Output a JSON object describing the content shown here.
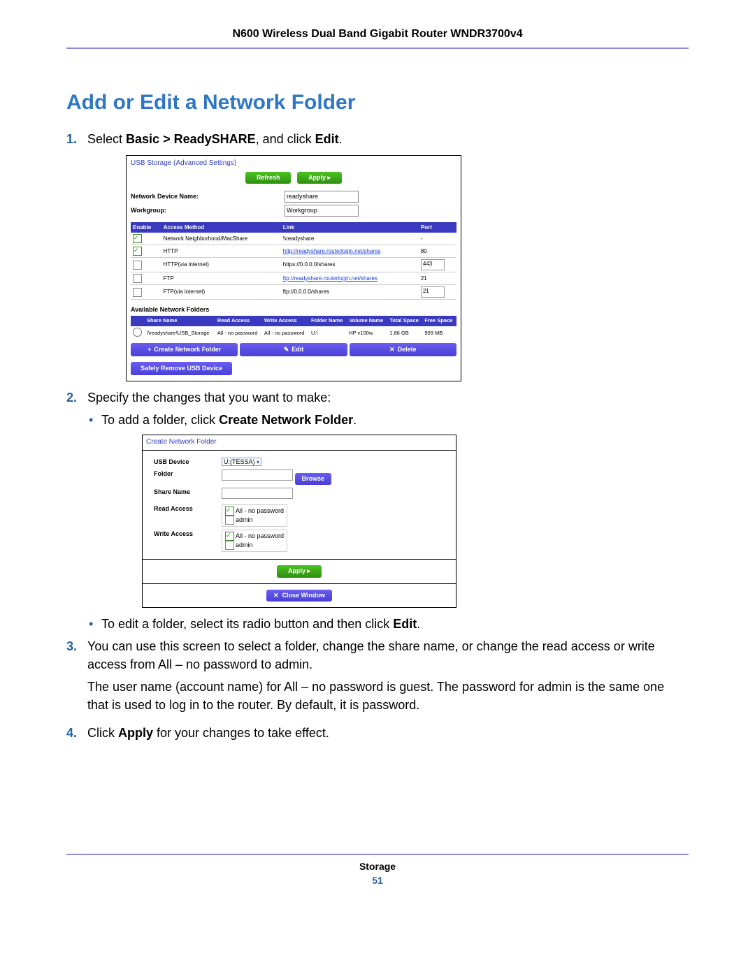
{
  "header": "N600 Wireless Dual Band Gigabit Router WNDR3700v4",
  "title": "Add or Edit a Network Folder",
  "step1": {
    "prefix": "Select ",
    "bold": "Basic > ReadySHARE",
    "mid": ", and click ",
    "bold2": "Edit",
    "suffix": "."
  },
  "panel1": {
    "title": "USB Storage (Advanced Settings)",
    "refresh": "Refresh",
    "apply": "Apply",
    "devname_lbl": "Network Device Name:",
    "devname": "readyshare",
    "workgroup_lbl": "Workgroup:",
    "workgroup": "Workgroup",
    "th": [
      "Enable",
      "Access Method",
      "Link",
      "Port"
    ],
    "rows": [
      {
        "en": "on",
        "m": "Network Neighborhood/MacShare",
        "l": "\\\\readyshare",
        "p": "-",
        "link": false
      },
      {
        "en": "on",
        "m": "HTTP",
        "l": "http://readyshare.routerlogin.net/shares",
        "p": "80",
        "link": true,
        "portbox": false
      },
      {
        "en": "off",
        "m": "HTTP(via internet)",
        "l": "https://0.0.0.0/shares",
        "p": "443",
        "link": false,
        "portbox": true
      },
      {
        "en": "off",
        "m": "FTP",
        "l": "ftp://readyshare.routerlogin.net/shares",
        "p": "21",
        "link": true,
        "portbox": false
      },
      {
        "en": "off",
        "m": "FTP(via internet)",
        "l": "ftp://0.0.0.0/shares",
        "p": "21",
        "link": false,
        "portbox": true
      }
    ],
    "avail": "Available Network Folders",
    "fth": [
      "",
      "Share Name",
      "Read Access",
      "Write Access",
      "Folder Name",
      "Volume Name",
      "Total Space",
      "Free Space"
    ],
    "frow": [
      "\\\\readyshare\\USB_Storage",
      "All - no password",
      "All - no password",
      "U:\\",
      "HP v100w",
      "1.86 GB",
      "909 MB"
    ],
    "btns": {
      "create": "Create Network Folder",
      "edit": "Edit",
      "delete": "Delete"
    },
    "safely": "Safely Remove USB Device"
  },
  "step2": {
    "text": "Specify the changes that you want to make:",
    "b1a": "To add a folder, click ",
    "b1b": "Create Network Folder",
    "b2a": "To edit a folder, select its radio button and then click ",
    "b2b": "Edit"
  },
  "panel2": {
    "title": "Create Network Folder",
    "usb_lbl": "USB Device",
    "usb_val": "U:(TESSA)",
    "folder_lbl": "Folder",
    "browse": "Browse",
    "share_lbl": "Share Name",
    "read_lbl": "Read Access",
    "write_lbl": "Write Access",
    "opt1": "All - no password",
    "opt2": "admin",
    "apply": "Apply",
    "close": "Close Window"
  },
  "step3": {
    "p1": "You can use this screen to select a folder, change the share name, or change the read access or write access from All – no password to admin.",
    "p2": "The user name (account name) for All – no password is guest. The password for admin is the same one that is used to log in to the router. By default, it is password."
  },
  "step4": {
    "a": "Click ",
    "b": "Apply",
    "c": " for your changes to take effect."
  },
  "footer": {
    "title": "Storage",
    "page": "51"
  }
}
